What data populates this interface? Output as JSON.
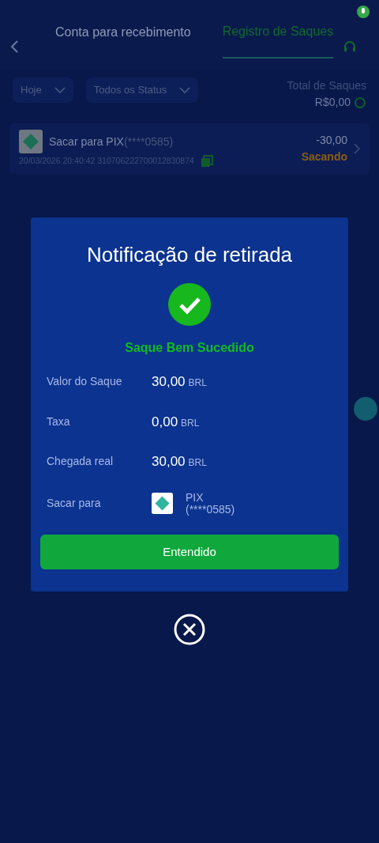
{
  "tabs": [
    {
      "label": "Conta para recebimento",
      "selected": false
    },
    {
      "label": "Registro de Saques",
      "selected": true
    }
  ],
  "filters": [
    {
      "label": "Hoje"
    },
    {
      "label": "Todos os Status"
    }
  ],
  "total": {
    "label": "Total de Saques",
    "amount": "R$0,00"
  },
  "record": {
    "title": "Sacar para  PIX",
    "account": "(****0585)",
    "meta": "20/03/2026 20:40:42 310706222700012830874",
    "amount": "-30,00",
    "status": "Sacando"
  },
  "modal": {
    "title": "Notificação de retirada",
    "status": "Saque Bem Sucedido",
    "rows": [
      {
        "kind": "amount",
        "label": "Valor do Saque",
        "value": "30,00",
        "currency": "BRL"
      },
      {
        "kind": "amount",
        "label": "Taxa",
        "value": "0,00",
        "currency": "BRL"
      },
      {
        "kind": "amount",
        "label": "Chegada real",
        "value": "30,00",
        "currency": "BRL"
      },
      {
        "kind": "destination",
        "label": "Sacar para",
        "value": "PIX",
        "currency": "(****0585)"
      }
    ],
    "button": "Entendido"
  }
}
